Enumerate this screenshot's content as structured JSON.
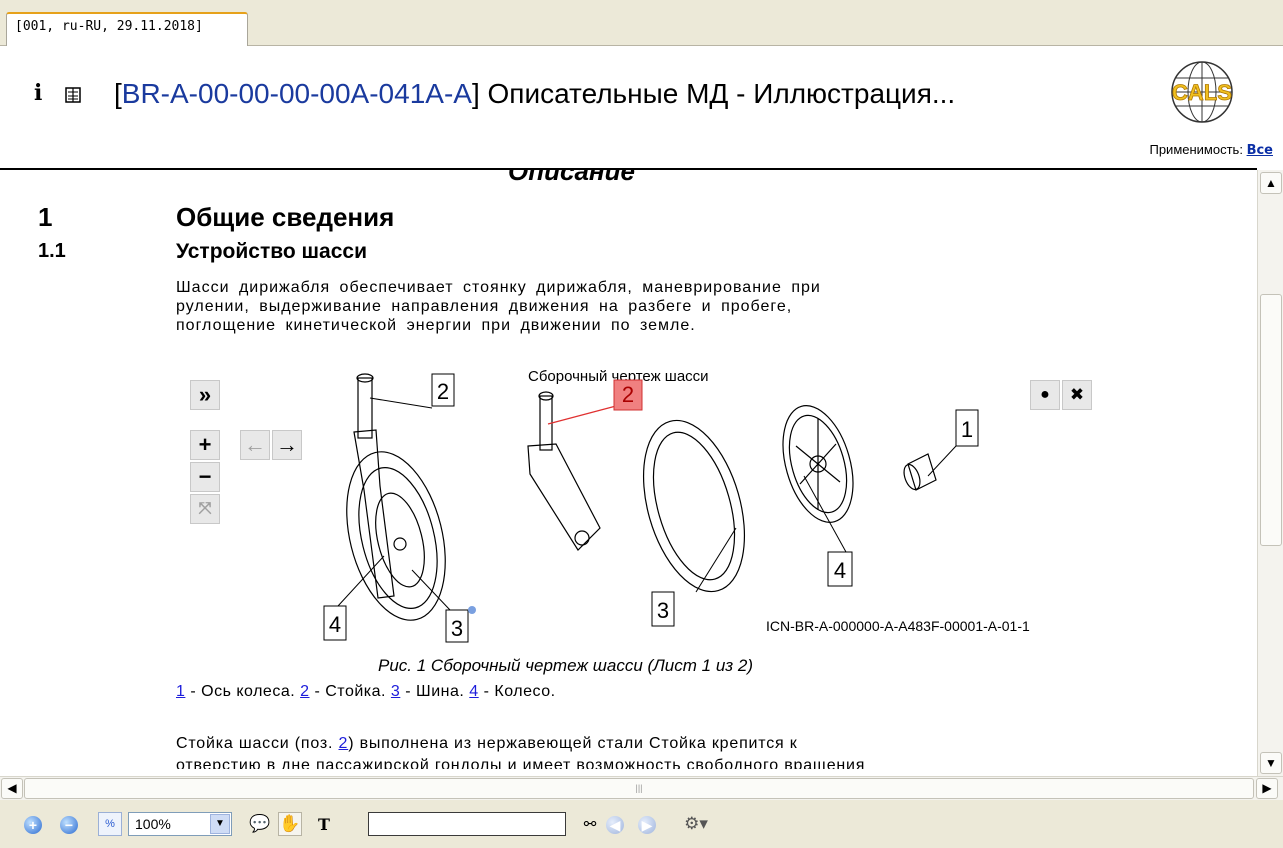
{
  "tab": {
    "label": "[001, ru-RU, 29.11.2018]"
  },
  "header": {
    "code": "BR-A-00-00-00-00A-041A-A",
    "title_rest": " Описательные МД - Иллюстрация...",
    "applicability_label": "Применимость:",
    "applicability_value": "Все",
    "logo_text": "CALS"
  },
  "document": {
    "section_title_cut": "Описание",
    "h1_number": "1",
    "h1_text": "Общие сведения",
    "h2_number": "1.1",
    "h2_text": "Устройство шасси",
    "paragraph1_lines": [
      "Шасси дирижабля обеспечивает  стоянку  дирижабля,  маневрирование  при",
      "рулении, выдерживание  направления  движения  на  разбеге  и  пробеге,",
      "поглощение  кинетической  энергии  при  движении  по  земле."
    ],
    "figure": {
      "hotspot_title": "Сборочный чертеж шасси",
      "icn": "ICN-BR-A-000000-A-A483F-00001-A-01-1",
      "caption": "Рис. 1   Сборочный  чертеж  шасси  (Лист  1  из  2)",
      "callouts": [
        "2",
        "2",
        "1",
        "4",
        "3",
        "4",
        "3"
      ],
      "controls": {
        "expand": "»",
        "zoom_in": "+",
        "zoom_out": "−",
        "fit": "⤧",
        "prev": "←",
        "next": "→",
        "dot": "●",
        "close": "✖"
      }
    },
    "legend": [
      {
        "num": "1",
        "text": " - Ось колеса. "
      },
      {
        "num": "2",
        "text": " - Стойка. "
      },
      {
        "num": "3",
        "text": " - Шина. "
      },
      {
        "num": "4",
        "text": " - Колесо."
      }
    ],
    "paragraph2_line1_pre": "Стойка шасси (поз. ",
    "paragraph2_line1_ref": "2",
    "paragraph2_line1_post": ") выполнена из нержавеющей стали Стойка крепится к",
    "paragraph2_line2": "отверстию в дне пассажирской гондолы и имеет возможность свободного вращения"
  },
  "toolbar": {
    "zoom_value": "100%",
    "search_value": ""
  }
}
